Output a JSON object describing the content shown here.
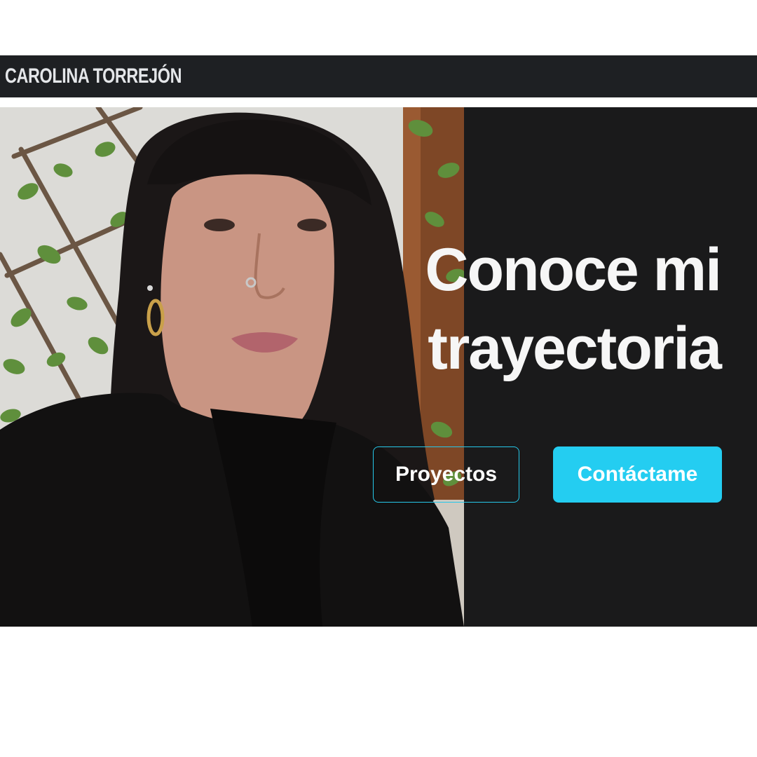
{
  "navbar": {
    "brand": "CAROLINA TORREJÓN"
  },
  "hero": {
    "headline_line1": "Conoce mi",
    "headline_line2": "trayectoria",
    "buttons": [
      {
        "label": "Proyectos"
      },
      {
        "label": "Contáctame"
      }
    ]
  },
  "colors": {
    "navbar_bg": "#1e2023",
    "hero_bg": "#1a1a1b",
    "accent": "#24cdf1",
    "text_light": "#f6f6f6"
  }
}
